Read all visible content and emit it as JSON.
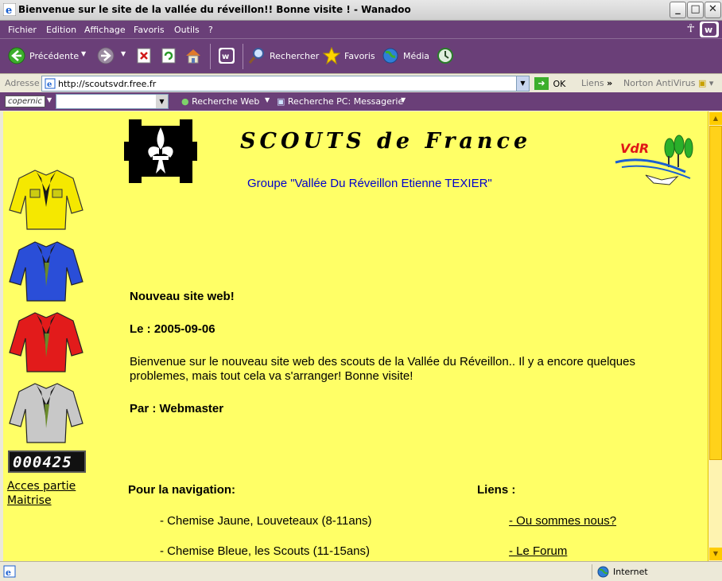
{
  "window": {
    "title": "Bienvenue sur le site de la vallée du réveillon!! Bonne visite ! - Wanadoo"
  },
  "menu": [
    "Fichier",
    "Edition",
    "Affichage",
    "Favoris",
    "Outils",
    "?"
  ],
  "toolbar": {
    "back": "Précédente",
    "search": "Rechercher",
    "favorites": "Favoris",
    "media": "Média"
  },
  "address": {
    "label": "Adresse",
    "url": "http://scoutsvdr.free.fr",
    "go": "OK",
    "links": "Liens",
    "norton": "Norton AntiVirus"
  },
  "copernic": {
    "logo": "copernic",
    "web_search": "Recherche Web",
    "pc_search": "Recherche PC: Messagerie"
  },
  "page": {
    "site_title": "SCOUTS de France",
    "group": "Groupe \"Vallée Du Réveillon Etienne TEXIER\"",
    "vdr": "VdR",
    "counter": "000425",
    "maitrise_link": "Acces partie Maitrise",
    "news": {
      "heading": "Nouveau site web!",
      "date_label": "Le : 2005-09-06",
      "body": "Bienvenue sur le nouveau site web des scouts de la Vallée du Réveillon.. Il y a encore quelques problemes, mais tout cela va s'arranger! Bonne visite!",
      "author": "Par : Webmaster"
    },
    "nav": {
      "heading": "Pour la navigation:",
      "items": [
        "- Chemise Jaune, Louveteaux (8-11ans)",
        "- Chemise Bleue, les Scouts (11-15ans)"
      ]
    },
    "links": {
      "heading": "Liens :",
      "items": [
        "- Ou sommes nous?",
        "- Le Forum"
      ]
    }
  },
  "shirts": [
    {
      "color": "#f5e800",
      "name": "yellow"
    },
    {
      "color": "#2a4ed8",
      "name": "blue"
    },
    {
      "color": "#e21b1b",
      "name": "red"
    },
    {
      "color": "#c8c8c8",
      "name": "grey"
    }
  ],
  "status": {
    "zone": "Internet"
  }
}
